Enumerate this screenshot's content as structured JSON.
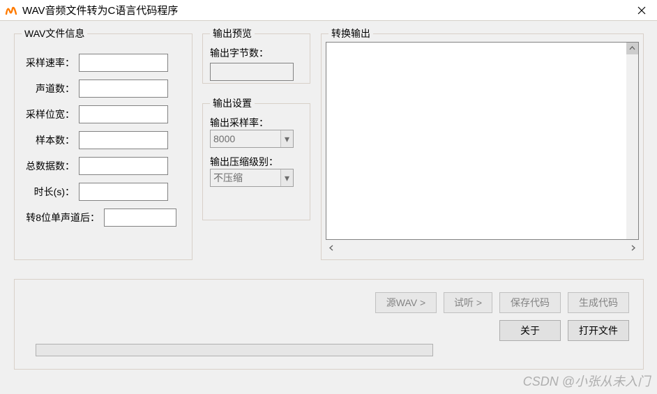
{
  "window": {
    "title": "WAV音频文件转为C语言代码程序"
  },
  "wav_info": {
    "legend": "WAV文件信息",
    "sample_rate_label": "采样速率：",
    "sample_rate": "",
    "channels_label": "声道数：",
    "channels": "",
    "bit_depth_label": "采样位宽：",
    "bit_depth": "",
    "samples_label": "样本数：",
    "samples": "",
    "data_size_label": "总数据数：",
    "data_size": "",
    "duration_label": "时长(s)：",
    "duration": "",
    "mono8_label": "转8位单声道后：",
    "mono8": ""
  },
  "preview": {
    "legend": "输出预览",
    "bytes_label": "输出字节数：",
    "bytes": ""
  },
  "settings": {
    "legend": "输出设置",
    "out_rate_label": "输出采样率：",
    "out_rate": "8000",
    "compress_label": "输出压缩级别：",
    "compress": "不压缩"
  },
  "output": {
    "legend": "转换输出",
    "text": ""
  },
  "buttons": {
    "source": "源WAV >",
    "listen": "试听 >",
    "save_code": "保存代码",
    "gen_code": "生成代码",
    "about": "关于",
    "open_file": "打开文件"
  },
  "watermark": "CSDN @小张从未入门"
}
